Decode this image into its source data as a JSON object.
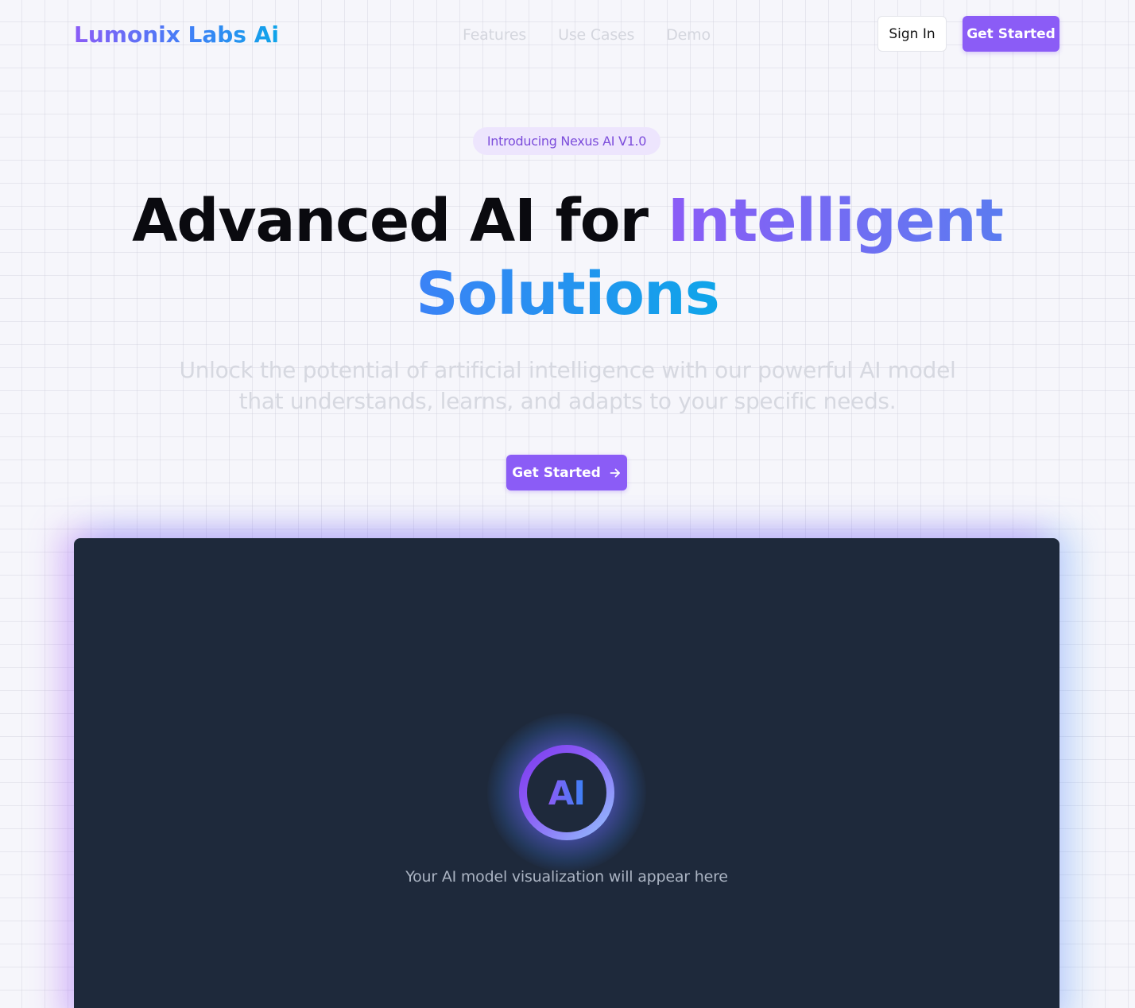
{
  "header": {
    "logo": "Lumonix Labs Ai",
    "nav": [
      "Features",
      "Use Cases",
      "Demo"
    ],
    "sign_in": "Sign In",
    "get_started": "Get Started"
  },
  "hero": {
    "badge": "Introducing Nexus AI V1.0",
    "headline_plain": "Advanced AI for ",
    "headline_grad1": "Intelligent",
    "headline_grad2": "Solutions",
    "subtitle": "Unlock the potential of artificial intelligence with our powerful AI model that understands, learns, and adapts to your specific needs.",
    "cta": "Get Started",
    "cta_icon": "arrow-right-icon"
  },
  "panel": {
    "orb_label": "AI",
    "caption": "Your AI model visualization will appear here"
  },
  "colors": {
    "accent": "#8b5cf6",
    "accent_blue": "#3b82f6",
    "panel_bg": "#1e293b"
  }
}
